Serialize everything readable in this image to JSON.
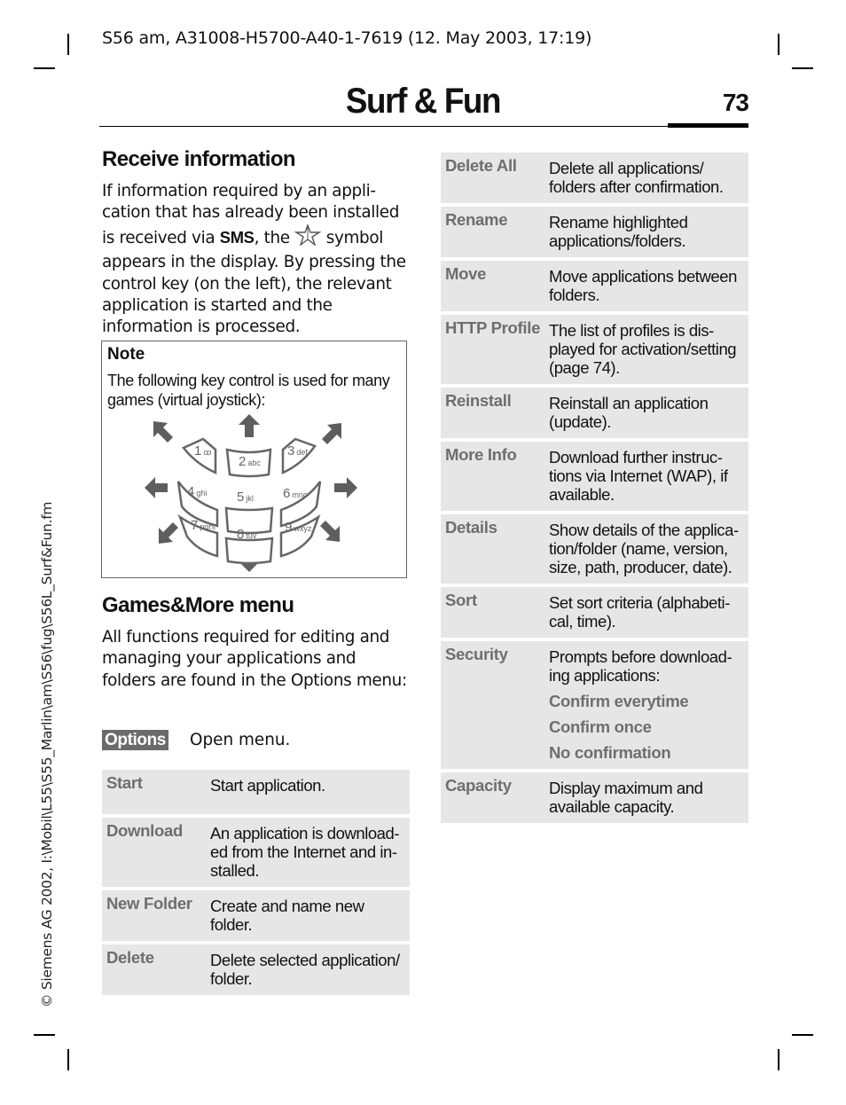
{
  "header": {
    "doc_info": "S56 am, A31008-H5700-A40-1-7619 (12. May 2003, 17:19)",
    "chapter_title": "Surf & Fun",
    "page_number": "73"
  },
  "sidebar": {
    "text": "© Siemens AG 2002, I:\\Mobil\\L55\\S55_Marlin\\am\\S56\\fug\\S56L_Surf&Fun.fm"
  },
  "receive_information": {
    "heading": "Receive information",
    "text_before_sms": "If information required by an appli­cation that has already been in­stalled is received via ",
    "sms": "SMS",
    "text_after_sms": ", the ",
    "icon": "star-icon",
    "text_after_icon": " symbol appears in the display. By pressing the control key (on the left), the relevant application is started and the information is processed."
  },
  "note": {
    "title": "Note",
    "text": "The following key control is used for many games (virtual joystick):",
    "keypad": {
      "keys": [
        {
          "digit": "1",
          "letters": "ꝏ"
        },
        {
          "digit": "2",
          "letters": "abc"
        },
        {
          "digit": "3",
          "letters": "def"
        },
        {
          "digit": "4",
          "letters": "ghi"
        },
        {
          "digit": "5",
          "letters": "jkl"
        },
        {
          "digit": "6",
          "letters": "mno"
        },
        {
          "digit": "7",
          "letters": "pqrs"
        },
        {
          "digit": "8",
          "letters": "tuv"
        },
        {
          "digit": "9",
          "letters": "wxyz"
        }
      ],
      "arrows": [
        "up-left",
        "up",
        "up-right",
        "left",
        "right",
        "down-left",
        "down",
        "down-right"
      ],
      "color": "#5e5e5e"
    }
  },
  "games_more": {
    "heading": "Games&More menu",
    "text": "All functions required for editing and managing your applications and folders are found in the Options menu:",
    "options_key": "Options",
    "options_desc": "Open menu."
  },
  "left_table": [
    {
      "label": "Start",
      "desc": "Start application."
    },
    {
      "label": "Download",
      "desc": "An application is download­ed from the Internet and in­stalled."
    },
    {
      "label": "New Folder",
      "desc": "Create and name new folder."
    },
    {
      "label": "Delete",
      "desc": "Delete selected application/ folder."
    }
  ],
  "right_table": [
    {
      "label": "Delete All",
      "desc": "Delete all applications/ folders after confirmation."
    },
    {
      "label": "Rename",
      "desc": "Rename highlighted applications/folders."
    },
    {
      "label": "Move",
      "desc": "Move applications between folders."
    },
    {
      "label": "HTTP Profile",
      "desc": "The list of profiles is dis­played for activation/setting (page 74)."
    },
    {
      "label": "Reinstall",
      "desc": "Reinstall an application (update)."
    },
    {
      "label": "More Info",
      "desc": "Download further instruc­tions via Internet (WAP), if available."
    },
    {
      "label": "Details",
      "desc": "Show details of the applica­tion/folder (name, version, size, path, producer, date)."
    },
    {
      "label": "Sort",
      "desc": "Set sort criteria (alphabeti­cal, time)."
    },
    {
      "label": "Security",
      "desc": "Prompts before download­ing applications:",
      "options": [
        "Confirm everytime",
        "Confirm once",
        "No confirmation"
      ]
    },
    {
      "label": "Capacity",
      "desc": "Display maximum and available capacity."
    }
  ],
  "colors": {
    "row_bg": "#e6e6e6",
    "label_gray": "#6e6e6e",
    "options_key_bg": "#6b6b6b"
  }
}
